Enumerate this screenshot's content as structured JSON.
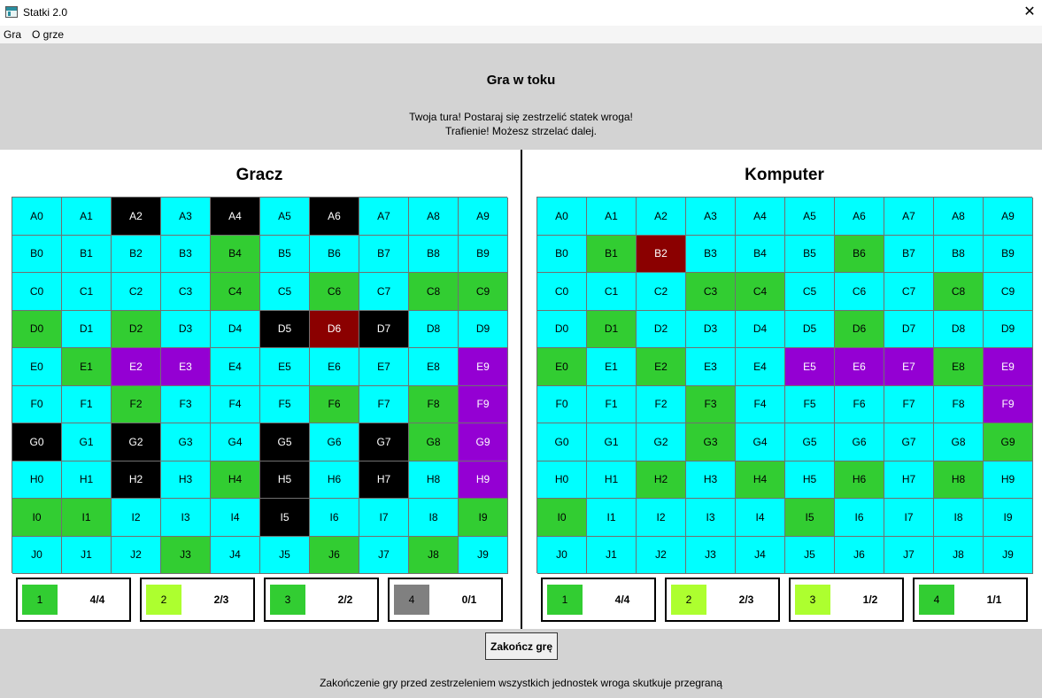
{
  "window": {
    "title": "Statki 2.0",
    "close_glyph": "✕"
  },
  "menu": [
    "Gra",
    "O grze"
  ],
  "status": {
    "title": "Gra w toku",
    "lines": [
      "Twoja tura! Postaraj się zestrzelić statek wroga!",
      "Trafienie! Możesz strzelać dalej."
    ]
  },
  "colors": {
    "water": "#00ffff",
    "ship": "#32cd32",
    "sunk": "#000000",
    "hit": "#8b0000",
    "miss": "#9400d3",
    "header_bg": "#d3d3d3",
    "legend_green": "#32cd32",
    "legend_lime": "#adff2f",
    "legend_gray": "#808080"
  },
  "player": {
    "title": "Gracz",
    "rows": [
      "wwswswswww",
      "wwwwgwwwww",
      "wwwwgwgwgg",
      "gwgwwshswwww",
      "wgmmwwwwwm",
      "wwgwwwgwgm",
      "swswwswsgm",
      "wwswgswswm",
      "ggwwwswwwg",
      "wwwgwwgwgw"
    ],
    "legend": [
      {
        "size": "1",
        "count": "4/4",
        "color": "legend_green"
      },
      {
        "size": "2",
        "count": "2/3",
        "color": "legend_lime"
      },
      {
        "size": "3",
        "count": "2/2",
        "color": "legend_green"
      },
      {
        "size": "4",
        "count": "0/1",
        "color": "legend_gray"
      }
    ]
  },
  "computer": {
    "title": "Komputer",
    "rows": [
      "wwwwwwwwww",
      "wghwwwgwww",
      "wwwggwwwgw",
      "wgwwwwgwww",
      "gwgwwmmmgm",
      "wwwgwwwwwm",
      "wwwgwwwwwg",
      "wwgwgwgwgw",
      "gwwwwgwwww",
      "wwwwwwwwww"
    ],
    "legend": [
      {
        "size": "1",
        "count": "4/4",
        "color": "legend_green"
      },
      {
        "size": "2",
        "count": "2/3",
        "color": "legend_lime"
      },
      {
        "size": "3",
        "count": "1/2",
        "color": "legend_lime"
      },
      {
        "size": "4",
        "count": "1/1",
        "color": "legend_green"
      }
    ]
  },
  "footer": {
    "button_label": "Zakończ grę",
    "note": "Zakończenie gry przed zestrzeleniem wszystkich jednostek wroga skutkuje przegraną"
  }
}
